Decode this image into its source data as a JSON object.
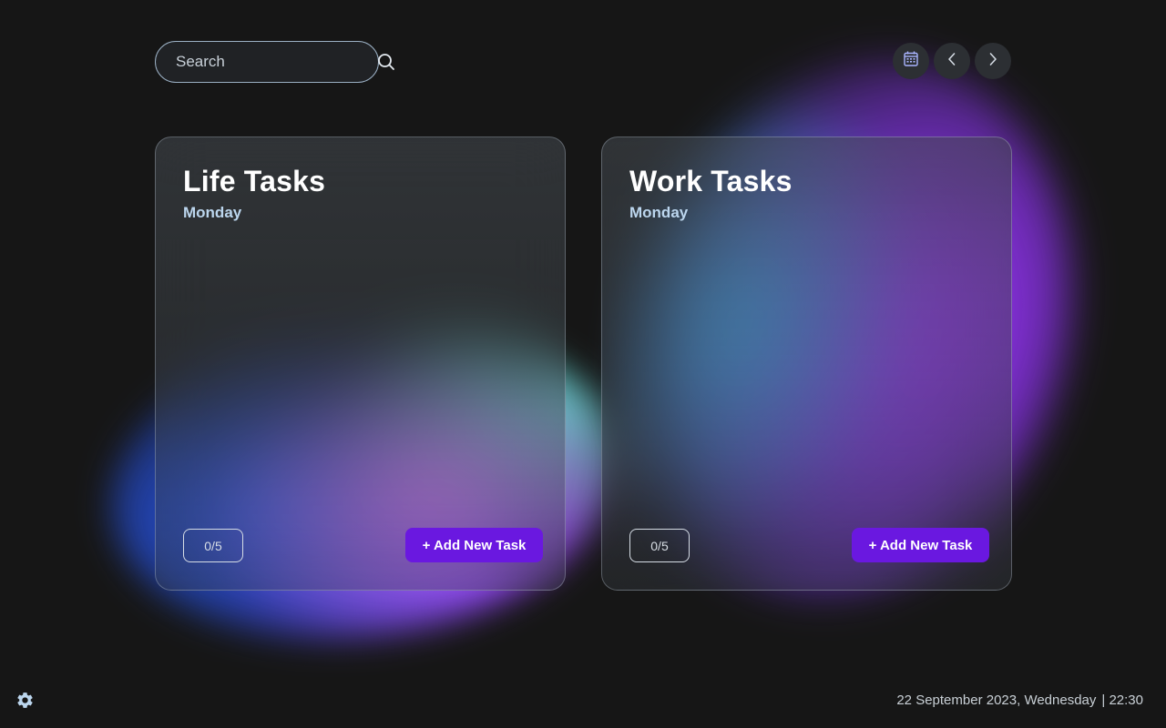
{
  "search": {
    "placeholder": "Search"
  },
  "nav": {
    "calendar_icon": "calendar-icon",
    "prev_icon": "chevron-left-icon",
    "next_icon": "chevron-right-icon"
  },
  "cards": [
    {
      "title": "Life Tasks",
      "day": "Monday",
      "counter": "0/5",
      "add_label": "+ Add New Task"
    },
    {
      "title": "Work Tasks",
      "day": "Monday",
      "counter": "0/5",
      "add_label": "+ Add New Task"
    }
  ],
  "footer": {
    "date": "22 September 2023, Wednesday",
    "time": "| 22:30",
    "settings_icon": "gear-icon"
  },
  "colors": {
    "background": "#161616",
    "accent": "#6a18e0",
    "day_label": "#bcd6ee"
  }
}
